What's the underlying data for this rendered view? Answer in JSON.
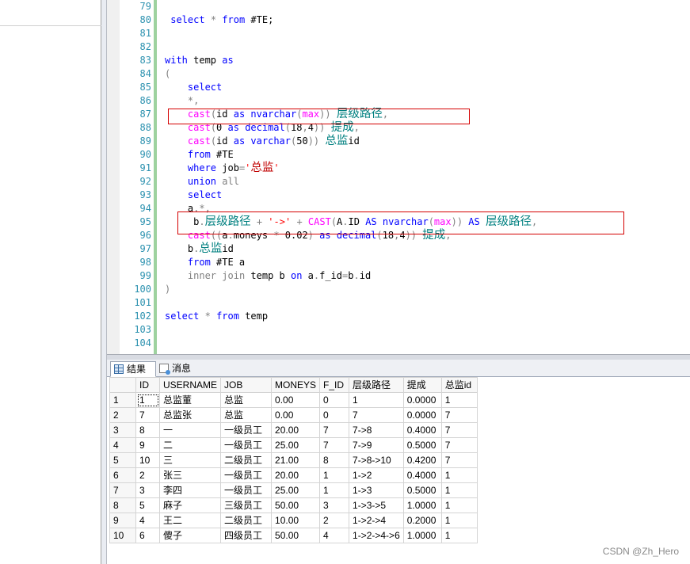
{
  "editor": {
    "line_numbers": [
      "79",
      "80",
      "81",
      "82",
      "83",
      "84",
      "85",
      "86",
      "87",
      "88",
      "89",
      "90",
      "91",
      "92",
      "93",
      "94",
      "95",
      "96",
      "97",
      "98",
      "99",
      "100",
      "101",
      "102",
      "103",
      "104"
    ]
  },
  "results": {
    "tab_results": "结果",
    "tab_messages": "消息",
    "columns": [
      "ID",
      "USERNAME",
      "JOB",
      "MONEYS",
      "F_ID",
      "层级路径",
      "提成",
      "总监id"
    ],
    "rows": [
      {
        "rn": "1",
        "cells": [
          "1",
          "总监董",
          "总监",
          "0.00",
          "0",
          "1",
          "0.0000",
          "1"
        ]
      },
      {
        "rn": "2",
        "cells": [
          "7",
          "总监张",
          "总监",
          "0.00",
          "0",
          "7",
          "0.0000",
          "7"
        ]
      },
      {
        "rn": "3",
        "cells": [
          "8",
          "一",
          "一级员工",
          "20.00",
          "7",
          "7->8",
          "0.4000",
          "7"
        ]
      },
      {
        "rn": "4",
        "cells": [
          "9",
          "二",
          "一级员工",
          "25.00",
          "7",
          "7->9",
          "0.5000",
          "7"
        ]
      },
      {
        "rn": "5",
        "cells": [
          "10",
          "三",
          "二级员工",
          "21.00",
          "8",
          "7->8->10",
          "0.4200",
          "7"
        ]
      },
      {
        "rn": "6",
        "cells": [
          "2",
          "张三",
          "一级员工",
          "20.00",
          "1",
          "1->2",
          "0.4000",
          "1"
        ]
      },
      {
        "rn": "7",
        "cells": [
          "3",
          "李四",
          "一级员工",
          "25.00",
          "1",
          "1->3",
          "0.5000",
          "1"
        ]
      },
      {
        "rn": "8",
        "cells": [
          "5",
          "麻子",
          "三级员工",
          "50.00",
          "3",
          "1->3->5",
          "1.0000",
          "1"
        ]
      },
      {
        "rn": "9",
        "cells": [
          "4",
          "王二",
          "二级员工",
          "10.00",
          "2",
          "1->2->4",
          "0.2000",
          "1"
        ]
      },
      {
        "rn": "10",
        "cells": [
          "6",
          "傻子",
          "四级员工",
          "50.00",
          "4",
          "1->2->4->6",
          "1.0000",
          "1"
        ]
      }
    ]
  },
  "watermark": "CSDN @Zh_Hero",
  "colors": {
    "keyword": "#0000ff",
    "operator": "#808080",
    "function": "#ff00ff",
    "string": "#ff0000",
    "line_number": "#2b91af",
    "highlight_box": "#d40000"
  }
}
